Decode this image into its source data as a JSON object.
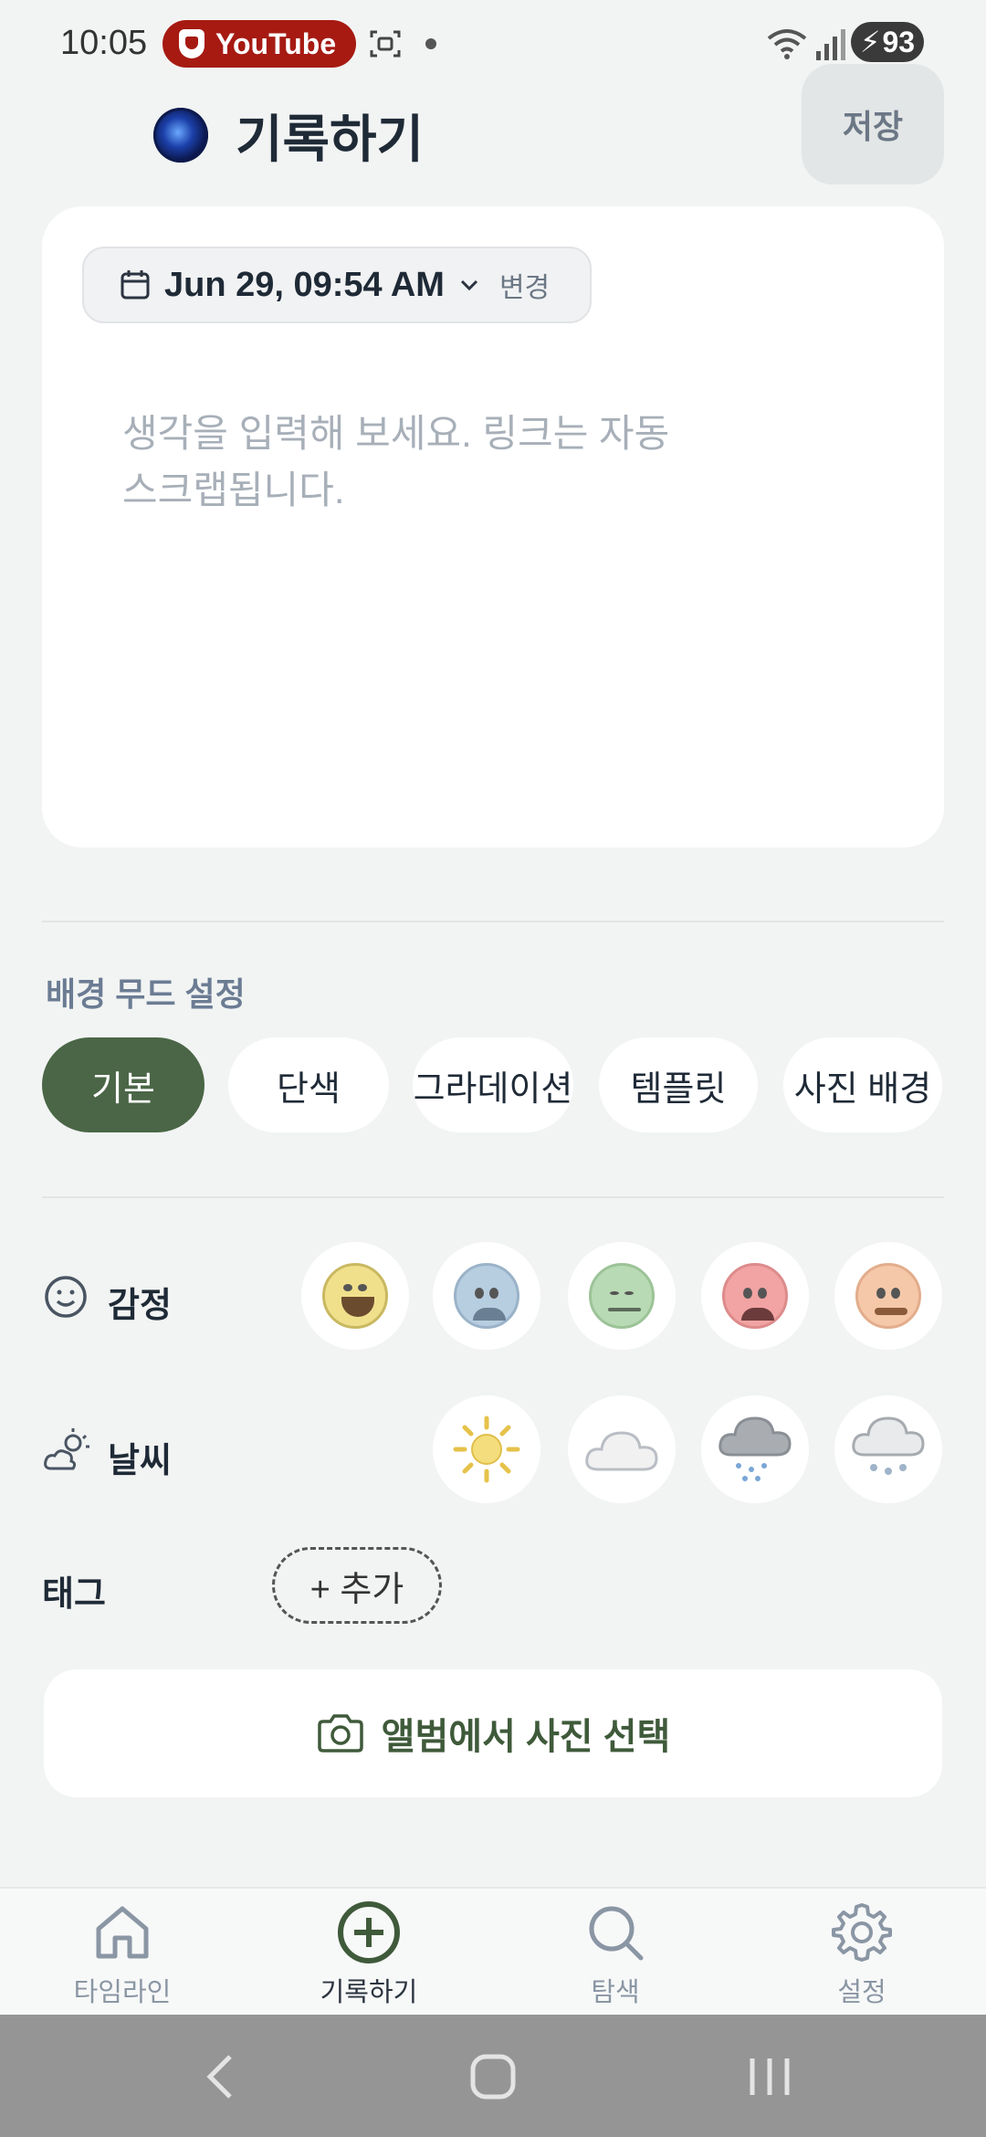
{
  "status_bar": {
    "time": "10:05",
    "app_pill": "YouTube",
    "battery": "93"
  },
  "header": {
    "title": "기록하기",
    "save_label": "저장"
  },
  "editor": {
    "date": "Jun 29, 09:54 AM",
    "change_label": "변경",
    "placeholder_line1": "생각을 입력해 보세요. 링크는 자동",
    "placeholder_line2": "스크랩됩니다."
  },
  "background_mood": {
    "label": "배경 무드 설정",
    "options": [
      "기본",
      "단색",
      "그라데이션",
      "템플릿",
      "사진 배경"
    ],
    "selected": "기본",
    "accent_color": "#4a6646"
  },
  "emotion": {
    "label": "감정",
    "icons": [
      "laughing-face-icon",
      "anxious-face-icon",
      "calm-face-icon",
      "angry-face-icon",
      "nervous-face-icon"
    ]
  },
  "weather": {
    "label": "날씨",
    "icons": [
      "sun-icon",
      "cloud-icon",
      "rain-cloud-icon",
      "snow-cloud-icon"
    ]
  },
  "tag": {
    "label": "태그",
    "add_label": "+ 추가"
  },
  "album": {
    "label": "앨범에서 사진 선택"
  },
  "bottom_nav": {
    "items": [
      {
        "label": "타임라인",
        "icon": "home-icon"
      },
      {
        "label": "기록하기",
        "icon": "plus-circle-icon",
        "active": true
      },
      {
        "label": "탐색",
        "icon": "search-icon"
      },
      {
        "label": "설정",
        "icon": "gear-icon"
      }
    ]
  }
}
